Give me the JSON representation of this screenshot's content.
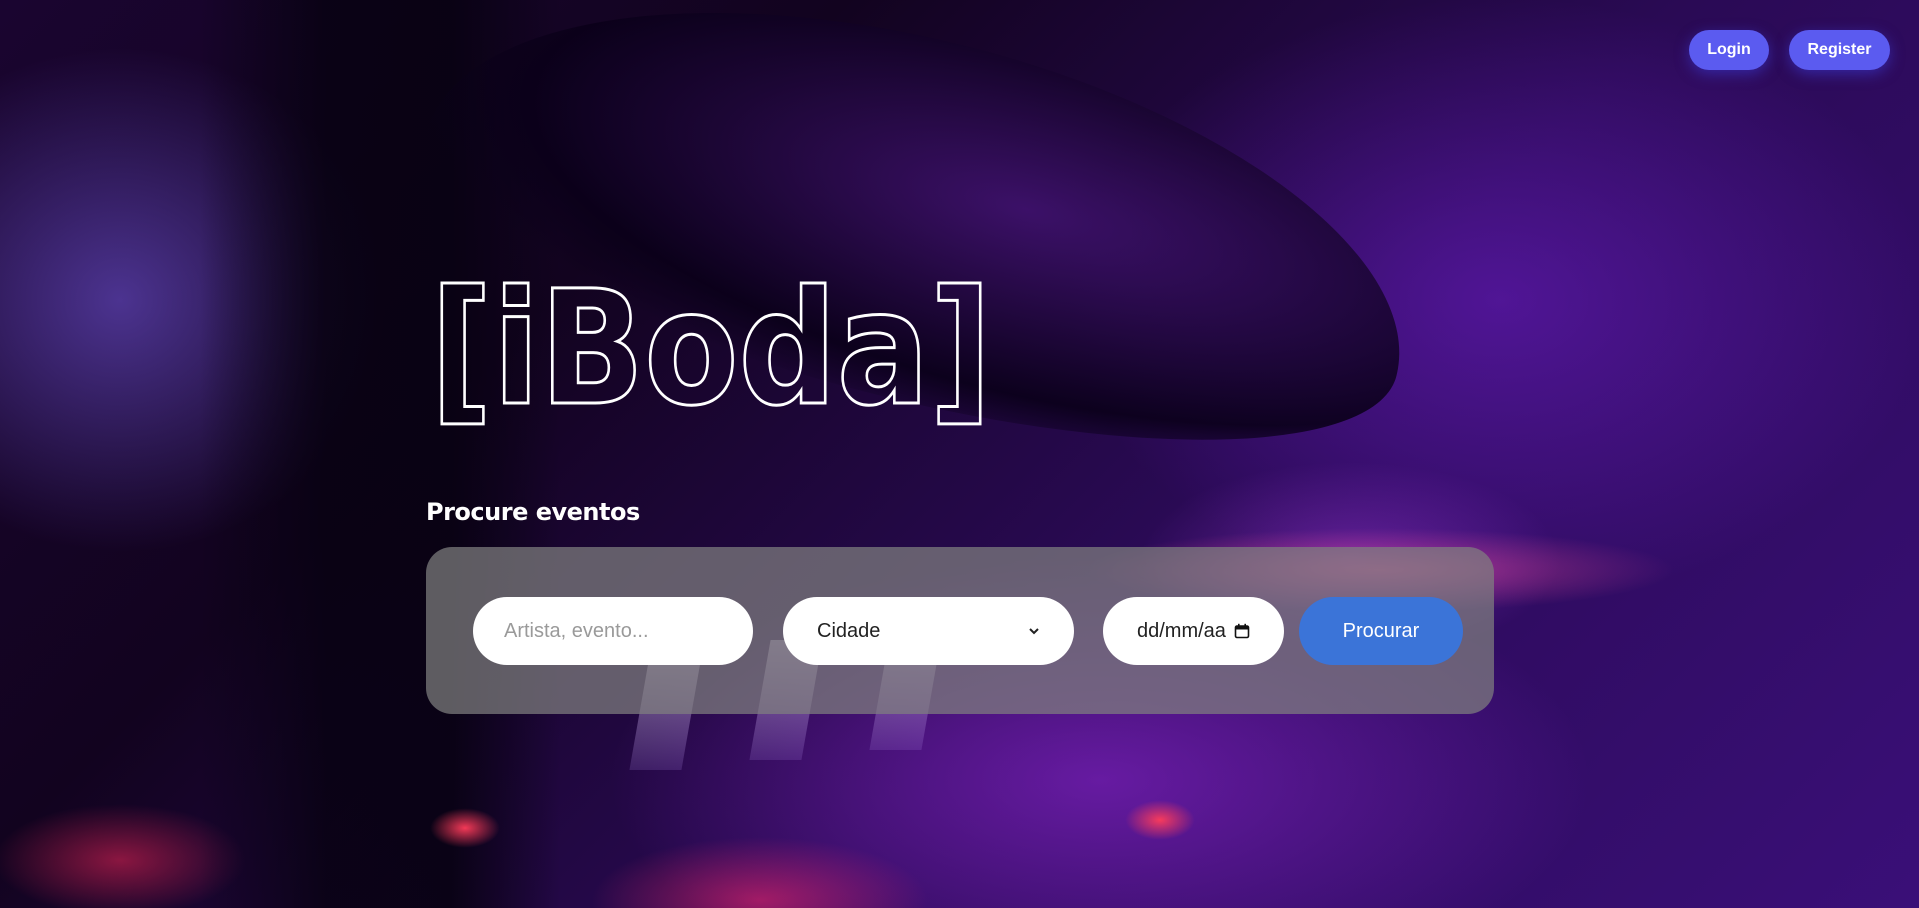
{
  "header": {
    "login_label": "Login",
    "register_label": "Register"
  },
  "logo": {
    "text": "[iBoda]"
  },
  "search": {
    "heading": "Procure eventos",
    "query_placeholder": "Artista, evento...",
    "query_value": "",
    "city_selected": "Cidade",
    "date_placeholder": "dd/mm/aa",
    "submit_label": "Procurar"
  },
  "colors": {
    "nav_button": "#5b5bf0",
    "search_button": "#3b74d8",
    "panel": "#808080"
  },
  "icons": {
    "city_dropdown": "chevron-down-icon",
    "date_picker": "calendar-icon"
  }
}
